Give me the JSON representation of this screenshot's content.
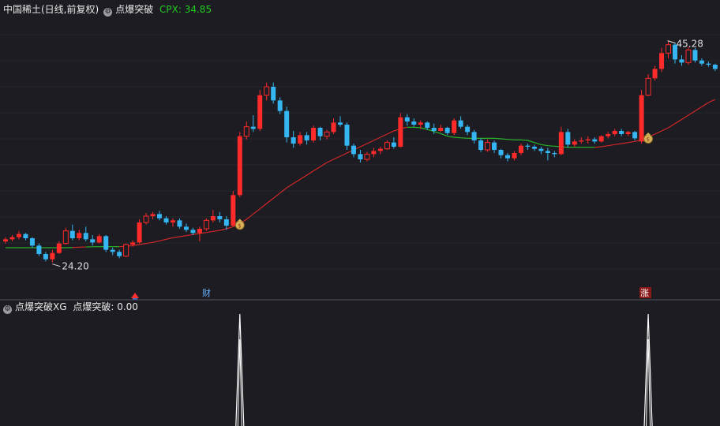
{
  "main_header": {
    "stock_title": "中国稀土(日线,前复权)",
    "indicator_name": "点爆突破",
    "cpx_label": "CPX: 34.85",
    "cpx_color": "#22cc22"
  },
  "sub_header": {
    "indicator_name": "点爆突破XG",
    "value_label": "点爆突破: 0.00"
  },
  "icons": {
    "header_settings": "gear-icon",
    "signal_marker": "money-bag-icon",
    "bottom_marker_1": "red-arrow-icon"
  },
  "markers": {
    "cai_label": "财",
    "zhang_label": "涨"
  },
  "colors": {
    "up": "#ff2a2a",
    "down": "#35b6f2",
    "ma_up": "#d42828",
    "ma_flat": "#2ab52a",
    "background": "#1c1c22",
    "signal": "#ffffff"
  },
  "chart_data": {
    "type": "candlestick",
    "title": "中国稀土(日线,前复权)",
    "high_label": "45.28",
    "low_label": "24.20",
    "y_range": [
      22.0,
      47.5
    ],
    "candles": [
      [
        26.2,
        26.6,
        26.0,
        26.4
      ],
      [
        26.4,
        26.8,
        26.2,
        26.6
      ],
      [
        26.6,
        27.2,
        26.4,
        26.9
      ],
      [
        26.9,
        27.0,
        26.3,
        26.5
      ],
      [
        26.5,
        26.6,
        25.6,
        25.8
      ],
      [
        25.8,
        26.0,
        24.8,
        25.0
      ],
      [
        25.0,
        25.2,
        24.3,
        24.5
      ],
      [
        24.5,
        25.4,
        24.2,
        25.1
      ],
      [
        25.1,
        26.2,
        25.0,
        26.0
      ],
      [
        26.0,
        27.5,
        25.9,
        27.2
      ],
      [
        27.2,
        27.8,
        26.3,
        26.5
      ],
      [
        26.5,
        27.3,
        26.3,
        27.0
      ],
      [
        27.0,
        27.6,
        26.2,
        26.4
      ],
      [
        26.4,
        26.8,
        25.8,
        26.1
      ],
      [
        26.1,
        26.9,
        26.0,
        26.7
      ],
      [
        26.7,
        26.8,
        25.2,
        25.4
      ],
      [
        25.4,
        25.6,
        24.9,
        25.2
      ],
      [
        25.2,
        25.4,
        24.6,
        24.8
      ],
      [
        24.8,
        26.0,
        24.7,
        25.9
      ],
      [
        25.9,
        26.3,
        25.7,
        26.1
      ],
      [
        26.1,
        28.3,
        26.0,
        28.0
      ],
      [
        28.0,
        28.9,
        27.8,
        28.6
      ],
      [
        28.6,
        29.0,
        28.3,
        28.8
      ],
      [
        28.8,
        29.1,
        28.2,
        28.4
      ],
      [
        28.4,
        28.6,
        27.8,
        28.0
      ],
      [
        28.0,
        28.4,
        27.6,
        28.2
      ],
      [
        28.2,
        28.4,
        27.4,
        27.6
      ],
      [
        27.6,
        27.9,
        27.1,
        27.3
      ],
      [
        27.3,
        27.5,
        26.8,
        27.0
      ],
      [
        27.0,
        27.6,
        26.2,
        27.4
      ],
      [
        27.4,
        28.4,
        27.2,
        28.2
      ],
      [
        28.2,
        29.2,
        28.0,
        28.6
      ],
      [
        28.6,
        29.0,
        28.0,
        28.3
      ],
      [
        28.3,
        28.6,
        27.3,
        27.7
      ],
      [
        27.7,
        31.0,
        27.6,
        30.6
      ],
      [
        30.6,
        36.6,
        30.4,
        36.2
      ],
      [
        36.2,
        37.6,
        35.9,
        37.1
      ],
      [
        37.1,
        38.2,
        36.6,
        36.9
      ],
      [
        36.9,
        40.6,
        36.7,
        40.1
      ],
      [
        40.1,
        41.3,
        39.6,
        40.9
      ],
      [
        40.9,
        41.3,
        39.3,
        39.6
      ],
      [
        39.6,
        39.9,
        38.3,
        38.6
      ],
      [
        38.6,
        39.0,
        35.6,
        36.1
      ],
      [
        36.1,
        36.7,
        35.1,
        35.5
      ],
      [
        35.5,
        36.6,
        35.3,
        36.3
      ],
      [
        36.3,
        36.6,
        35.4,
        35.8
      ],
      [
        35.8,
        37.2,
        35.6,
        37.0
      ],
      [
        37.0,
        37.1,
        35.8,
        36.2
      ],
      [
        36.2,
        36.8,
        35.9,
        36.6
      ],
      [
        36.6,
        37.9,
        36.4,
        37.5
      ],
      [
        37.5,
        38.1,
        37.1,
        37.3
      ],
      [
        37.3,
        37.5,
        34.9,
        35.3
      ],
      [
        35.3,
        35.5,
        34.2,
        34.5
      ],
      [
        34.5,
        34.9,
        33.7,
        34.0
      ],
      [
        34.0,
        34.7,
        33.8,
        34.5
      ],
      [
        34.5,
        35.1,
        34.2,
        34.8
      ],
      [
        34.8,
        35.2,
        34.5,
        35.0
      ],
      [
        35.0,
        35.8,
        34.9,
        35.6
      ],
      [
        35.6,
        36.1,
        35.0,
        35.2
      ],
      [
        35.2,
        38.4,
        35.1,
        38.0
      ],
      [
        38.0,
        38.3,
        37.2,
        37.6
      ],
      [
        37.6,
        37.9,
        37.1,
        37.3
      ],
      [
        37.3,
        37.7,
        36.9,
        37.5
      ],
      [
        37.5,
        37.6,
        36.8,
        37.0
      ],
      [
        37.0,
        37.4,
        36.4,
        36.7
      ],
      [
        36.7,
        37.3,
        36.6,
        37.0
      ],
      [
        37.0,
        37.1,
        36.3,
        36.5
      ],
      [
        36.5,
        37.9,
        36.3,
        37.7
      ],
      [
        37.7,
        38.1,
        36.9,
        37.1
      ],
      [
        37.1,
        37.3,
        36.3,
        36.6
      ],
      [
        36.6,
        36.8,
        35.5,
        35.8
      ],
      [
        35.8,
        36.0,
        34.7,
        34.9
      ],
      [
        34.9,
        35.9,
        34.7,
        35.6
      ],
      [
        35.6,
        35.8,
        34.6,
        34.9
      ],
      [
        34.9,
        35.0,
        34.1,
        34.4
      ],
      [
        34.4,
        34.6,
        33.8,
        34.1
      ],
      [
        34.1,
        34.8,
        33.9,
        34.6
      ],
      [
        34.6,
        35.5,
        34.4,
        35.3
      ],
      [
        35.3,
        35.5,
        34.9,
        35.2
      ],
      [
        35.2,
        35.4,
        34.8,
        35.0
      ],
      [
        35.0,
        35.2,
        34.5,
        34.8
      ],
      [
        34.8,
        35.1,
        33.9,
        34.6
      ],
      [
        34.6,
        34.8,
        34.2,
        34.5
      ],
      [
        34.5,
        37.1,
        34.4,
        36.6
      ],
      [
        36.6,
        36.9,
        35.1,
        35.4
      ],
      [
        35.4,
        35.9,
        35.2,
        35.7
      ],
      [
        35.7,
        36.1,
        35.5,
        35.8
      ],
      [
        35.8,
        36.2,
        35.5,
        35.9
      ],
      [
        35.9,
        36.1,
        35.5,
        35.7
      ],
      [
        35.7,
        36.3,
        35.6,
        36.2
      ],
      [
        36.2,
        36.6,
        36.0,
        36.4
      ],
      [
        36.4,
        36.9,
        36.2,
        36.7
      ],
      [
        36.7,
        36.9,
        36.2,
        36.4
      ],
      [
        36.4,
        36.7,
        36.2,
        36.6
      ],
      [
        36.6,
        36.7,
        35.8,
        36.0
      ],
      [
        35.7,
        40.6,
        35.5,
        40.1
      ],
      [
        40.1,
        42.1,
        40.0,
        41.7
      ],
      [
        41.7,
        42.9,
        41.5,
        42.6
      ],
      [
        42.6,
        44.6,
        42.3,
        44.1
      ],
      [
        44.1,
        45.28,
        43.6,
        44.9
      ],
      [
        44.9,
        45.1,
        43.1,
        43.5
      ],
      [
        43.5,
        43.9,
        42.9,
        43.2
      ],
      [
        43.2,
        44.7,
        43.0,
        44.4
      ],
      [
        44.4,
        44.6,
        43.2,
        43.4
      ],
      [
        43.4,
        43.6,
        42.9,
        43.1
      ],
      [
        43.1,
        43.3,
        42.8,
        43.0
      ],
      [
        43.0,
        43.1,
        42.4,
        42.6
      ]
    ],
    "moving_average": [
      25.6,
      25.6,
      25.6,
      25.6,
      25.6,
      25.6,
      25.6,
      25.6,
      25.6,
      25.6,
      25.62,
      25.65,
      25.67,
      25.69,
      25.7,
      25.7,
      25.7,
      25.7,
      25.73,
      25.8,
      25.9,
      26.0,
      26.1,
      26.25,
      26.4,
      26.55,
      26.65,
      26.75,
      26.85,
      26.95,
      27.05,
      27.15,
      27.25,
      27.4,
      27.6,
      27.9,
      28.3,
      28.8,
      29.3,
      29.8,
      30.3,
      30.8,
      31.3,
      31.7,
      32.1,
      32.5,
      32.9,
      33.3,
      33.7,
      34.0,
      34.3,
      34.6,
      34.9,
      35.2,
      35.5,
      35.8,
      36.1,
      36.4,
      36.7,
      36.9,
      37.05,
      37.05,
      37.0,
      36.85,
      36.65,
      36.45,
      36.2,
      36.1,
      36.05,
      36.0,
      36.0,
      36.0,
      36.0,
      36.0,
      35.95,
      35.9,
      35.85,
      35.85,
      35.8,
      35.6,
      35.4,
      35.3,
      35.25,
      35.2,
      35.15,
      35.15,
      35.15,
      35.15,
      35.15,
      35.2,
      35.3,
      35.4,
      35.5,
      35.6,
      35.7,
      35.85,
      36.1,
      36.4,
      36.7,
      37.0,
      37.4,
      37.8,
      38.2,
      38.6,
      39.0,
      39.4,
      39.7
    ],
    "signal_bars": [
      35,
      96
    ]
  }
}
